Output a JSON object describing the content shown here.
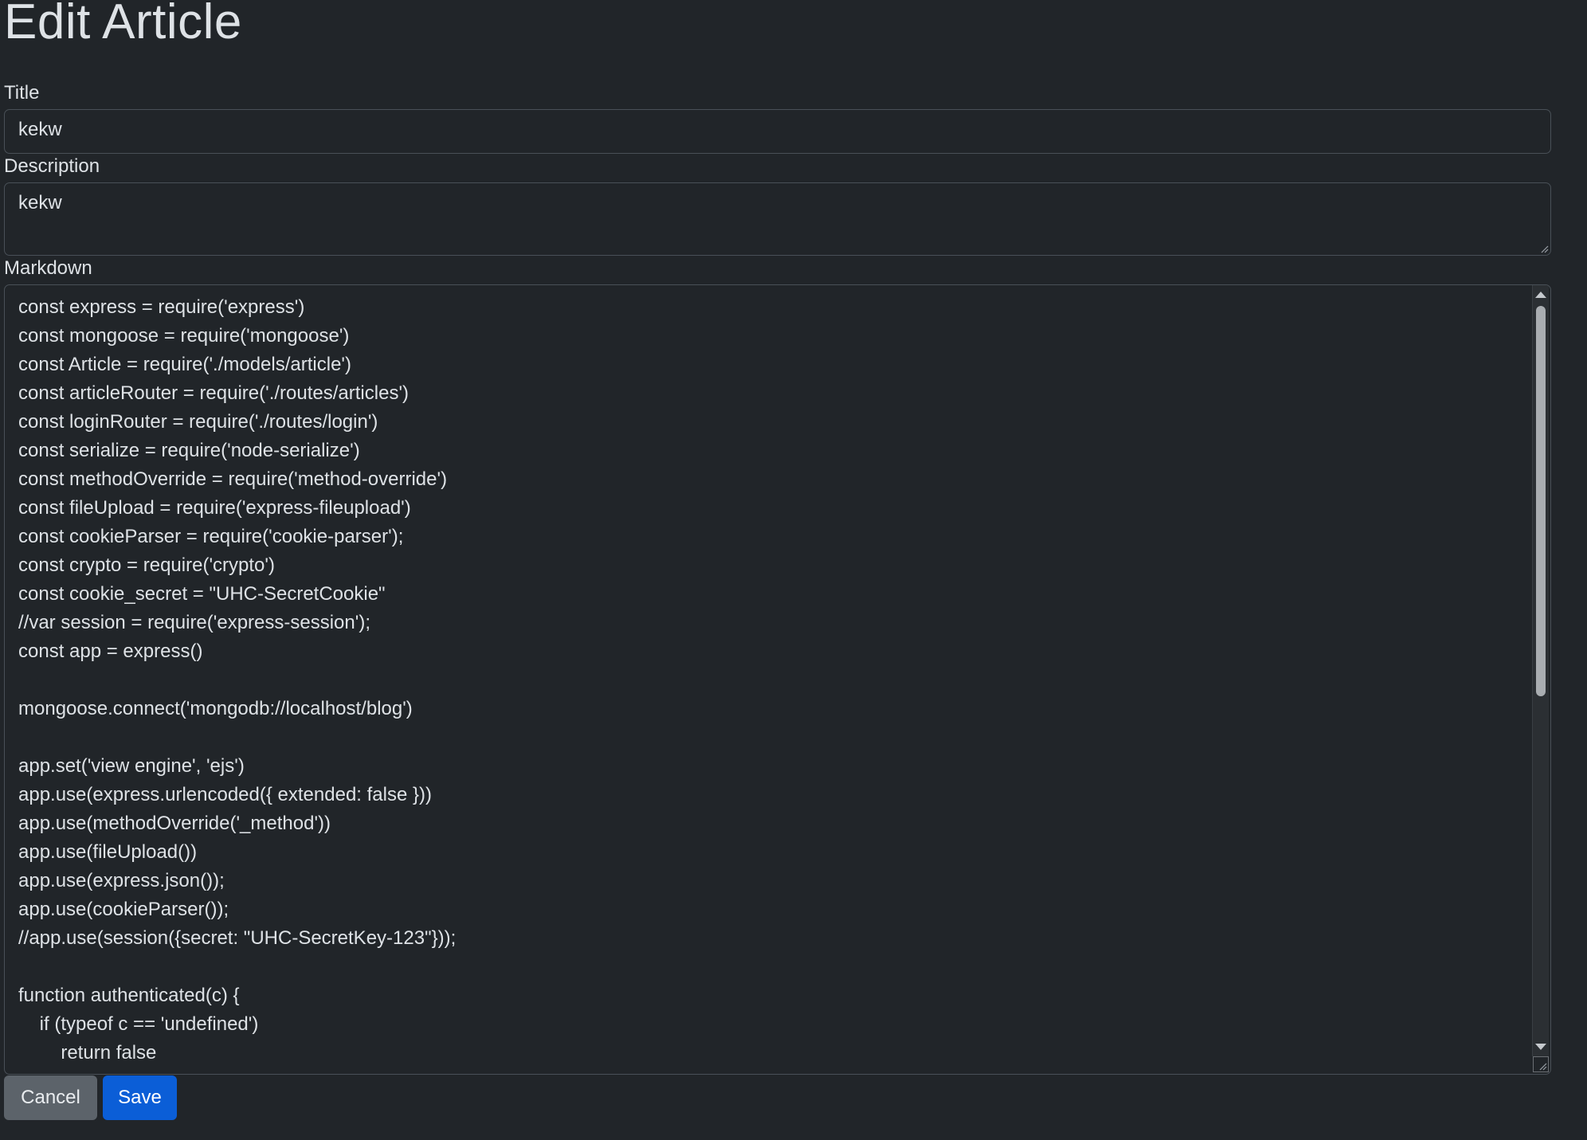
{
  "page": {
    "heading": "Edit Article"
  },
  "form": {
    "title_label": "Title",
    "title_value": "kekw",
    "description_label": "Description",
    "description_value": "kekw",
    "markdown_label": "Markdown",
    "markdown_lines": [
      "const express = require('express')",
      "const mongoose = require('mongoose')",
      "const Article = require('./models/article')",
      "const articleRouter = require('./routes/articles')",
      "const loginRouter = require('./routes/login')",
      "const serialize = require('node-serialize')",
      "const methodOverride = require('method-override')",
      "const fileUpload = require('express-fileupload')",
      "const cookieParser = require('cookie-parser');",
      "const crypto = require('crypto')",
      "const cookie_secret = \"UHC-SecretCookie\"",
      "//var session = require('express-session');",
      "const app = express()",
      "",
      "mongoose.connect('mongodb://localhost/blog')",
      "",
      "app.set('view engine', 'ejs')",
      "app.use(express.urlencoded({ extended: false }))",
      "app.use(methodOverride('_method'))",
      "app.use(fileUpload())",
      "app.use(express.json());",
      "app.use(cookieParser());",
      "//app.use(session({secret: \"UHC-SecretKey-123\"}));",
      "",
      "function authenticated(c) {",
      "    if (typeof c == 'undefined')",
      "        return false"
    ]
  },
  "buttons": {
    "cancel_label": "Cancel",
    "save_label": "Save"
  },
  "colors": {
    "background": "#212529",
    "cancel": "#5c636a",
    "save": "#0b5ed7"
  }
}
